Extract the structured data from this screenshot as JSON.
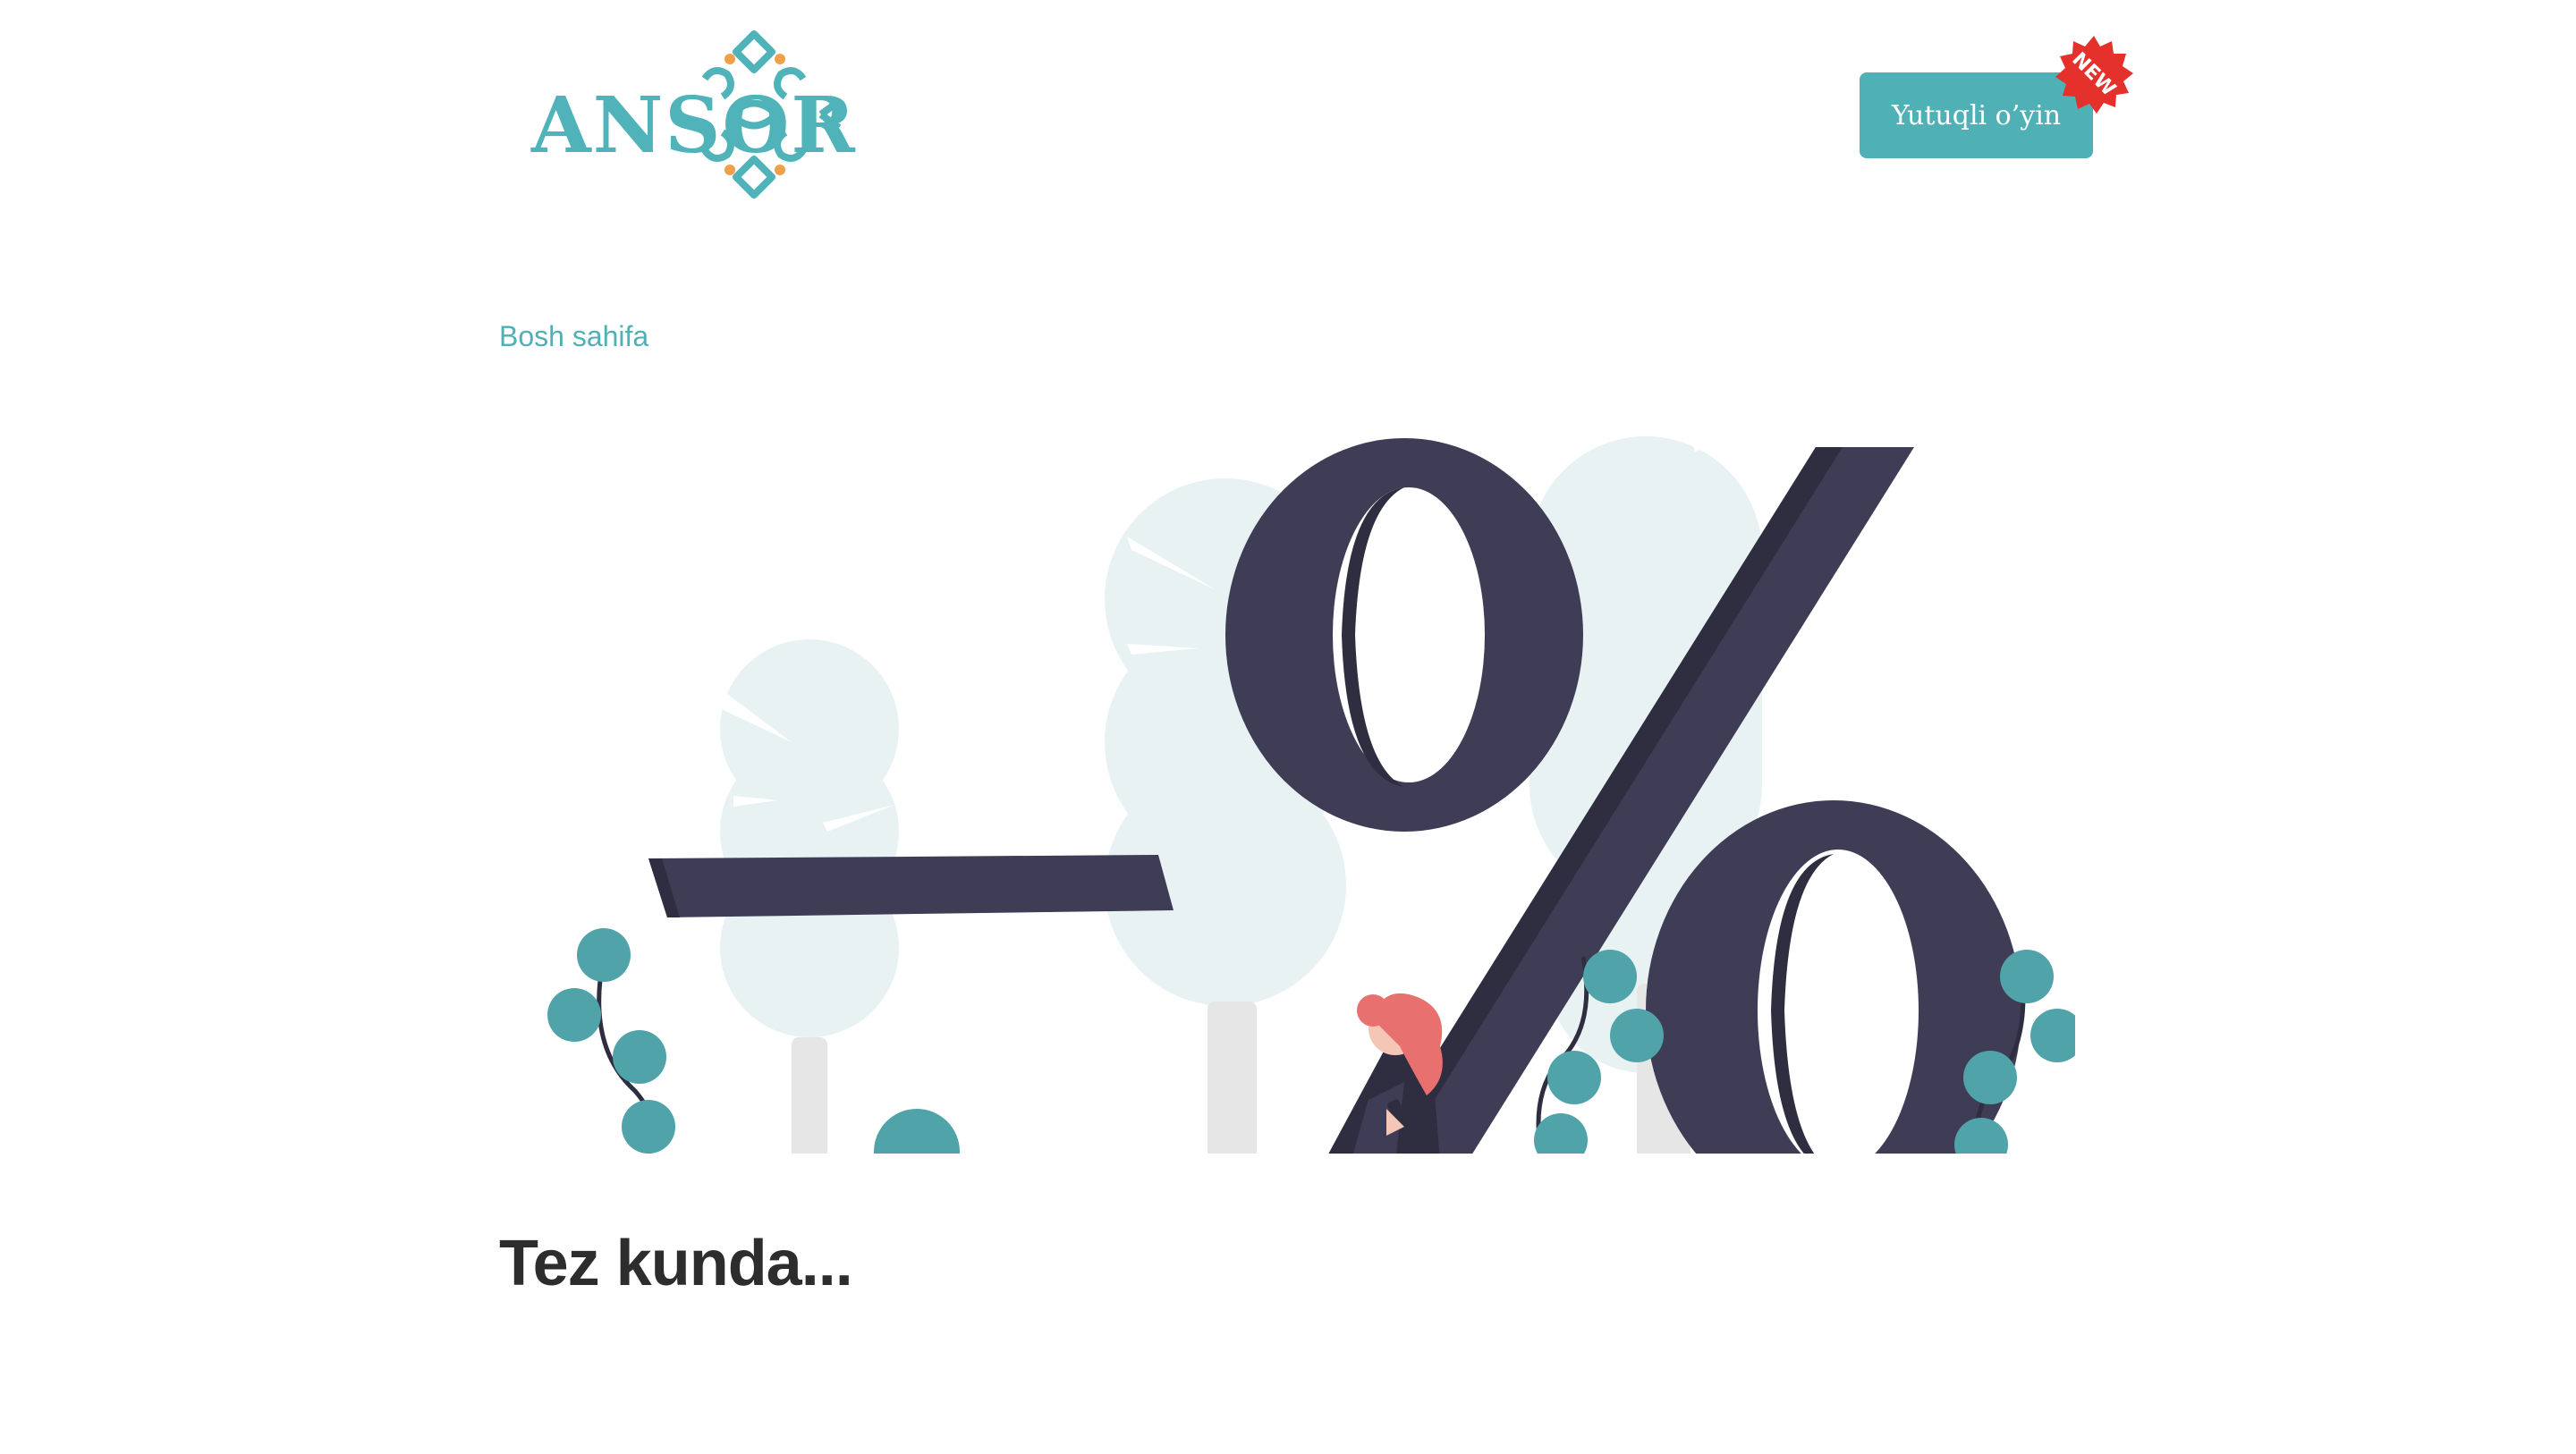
{
  "header": {
    "logo_text": "ANSOR",
    "game_button_label": "Yutuqli o’yin",
    "new_badge_label": "NEW"
  },
  "breadcrumb": {
    "home_label": "Bosh sahifa"
  },
  "main": {
    "title": "Tez kunda..."
  },
  "colors": {
    "accent": "#4fb0b6",
    "badge": "#e4312b",
    "title": "#2d2d2d",
    "illustration_dark": "#3f3d56",
    "illustration_light": "#e8f2f3",
    "person_hair": "#e8706f"
  },
  "illustration": {
    "name": "discount-percent-illustration"
  }
}
